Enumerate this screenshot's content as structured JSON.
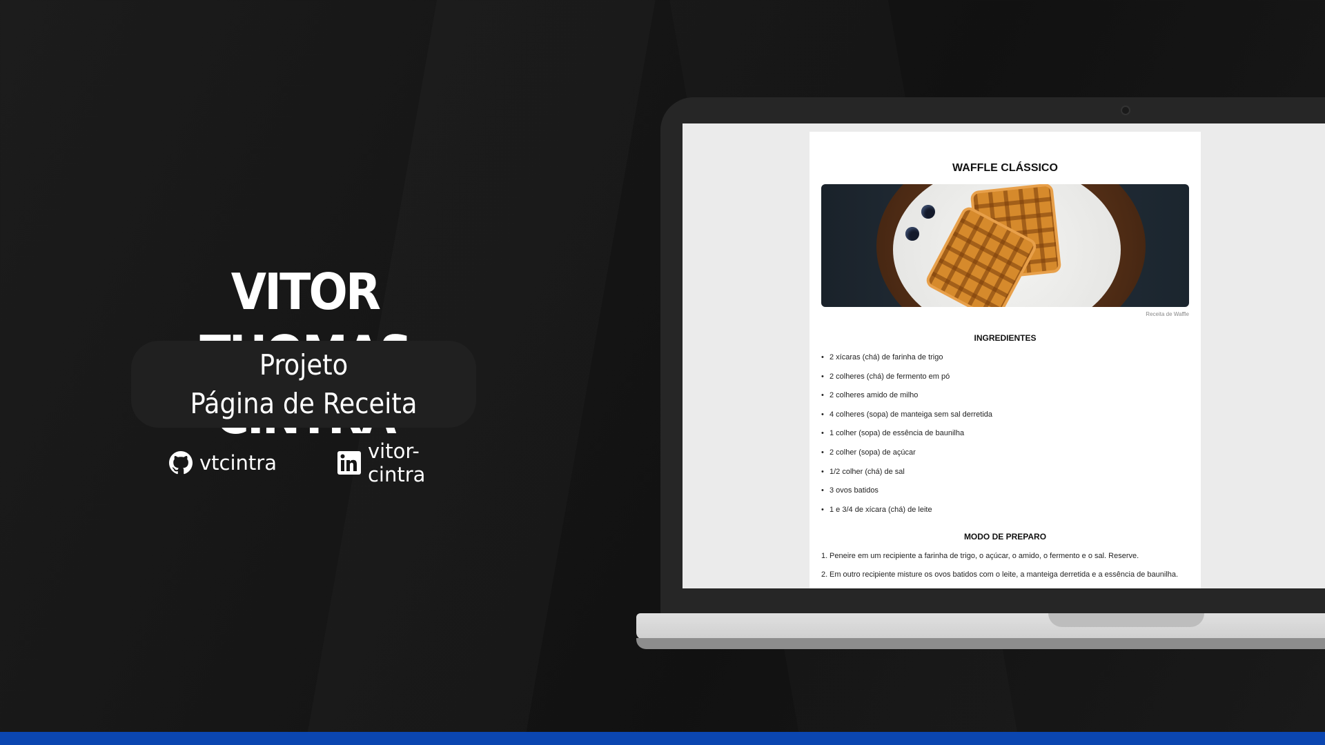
{
  "author": {
    "name": "VITOR THOMAS CINTRA"
  },
  "project": {
    "line1": "Projeto",
    "line2": "Página de Receita"
  },
  "socials": {
    "github_label": "vtcintra",
    "linkedin_label": "vitor-cintra",
    "github_icon": "github-icon",
    "linkedin_icon": "linkedin-icon"
  },
  "colors": {
    "accent_bar": "#0b46b0",
    "background": "#151515"
  },
  "recipe": {
    "title": "WAFFLE CLÁSSICO",
    "image_caption": "Receita de Waffle",
    "ingredients_title": "INGREDIENTES",
    "ingredients": [
      "2 xícaras (chá) de farinha de trigo",
      "2 colheres (chá) de fermento em pó",
      "2 colheres amido de milho",
      "4 colheres (sopa) de manteiga sem sal derretida",
      "1 colher (sopa) de essência de baunilha",
      "2 colher (sopa) de açúcar",
      "1/2 colher (chá) de sal",
      "3 ovos batidos",
      "1 e 3/4 de xícara (chá) de leite"
    ],
    "steps_title": "MODO DE PREPARO",
    "steps": [
      {
        "num": "1.",
        "text": "Peneire em um recipiente a farinha de trigo, o açúcar, o amido, o fermento e o sal. Reserve."
      },
      {
        "num": "2.",
        "text": "Em outro recipiente misture os ovos batidos com o leite, a manteiga derretida e a essência de baunilha."
      }
    ]
  }
}
